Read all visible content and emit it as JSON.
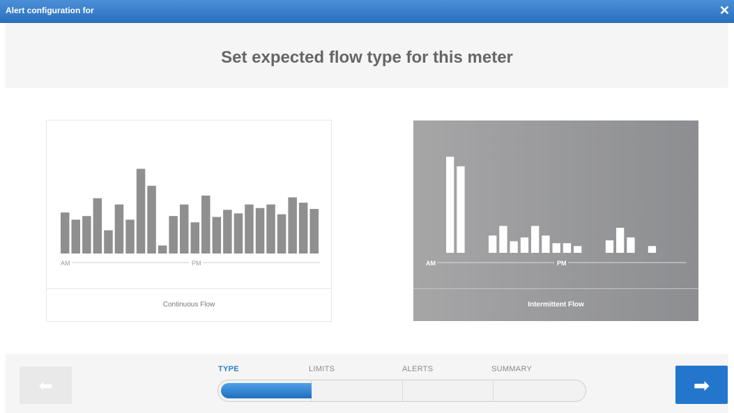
{
  "window": {
    "title": "Alert configuration for",
    "close_glyph": "✕"
  },
  "header": {
    "title": "Set expected flow type for this meter"
  },
  "cards": [
    {
      "label": "Continuous Flow",
      "axis": {
        "left": "AM",
        "mid": "PM"
      },
      "bars": [
        0.46,
        0.38,
        0.42,
        0.62,
        0.26,
        0.55,
        0.38,
        0.95,
        0.76,
        0.09,
        0.42,
        0.55,
        0.35,
        0.65,
        0.41,
        0.49,
        0.45,
        0.55,
        0.51,
        0.55,
        0.44,
        0.63,
        0.57,
        0.5
      ],
      "selected": false
    },
    {
      "label": "Intermittent Flow",
      "axis": {
        "left": "AM",
        "mid": "PM"
      },
      "bars": [
        1.0,
        0.9,
        0,
        0,
        0.18,
        0.28,
        0.12,
        0.16,
        0.28,
        0.18,
        0.1,
        0.1,
        0.07,
        0,
        0,
        0.13,
        0.26,
        0.16,
        0,
        0.07
      ],
      "selected": true
    }
  ],
  "wizard": {
    "steps": [
      "TYPE",
      "LIMITS",
      "ALERTS",
      "SUMMARY"
    ],
    "active_step": 0,
    "progress": 0.25
  },
  "nav": {
    "back_icon": "arrow-left-icon",
    "next_icon": "arrow-right-icon",
    "back_glyph": "⬅",
    "next_glyph": "➡"
  },
  "colors": {
    "accent": "#2376cc",
    "titlebar": "#2a6fbe",
    "bar_dark": "#8f8f8f",
    "bar_light": "#ffffff",
    "selected_card": "#9a9b9d"
  }
}
